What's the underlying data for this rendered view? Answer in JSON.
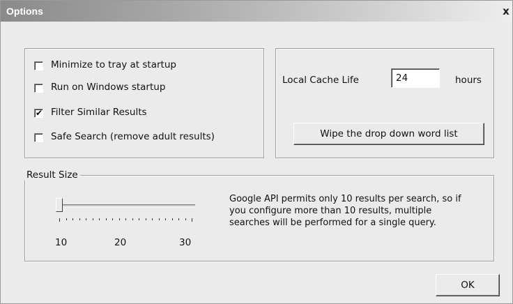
{
  "window": {
    "title": "Options",
    "close_glyph": "x"
  },
  "checkboxes": [
    {
      "label": "Minimize to tray at startup",
      "checked": false
    },
    {
      "label": "Run on Windows startup",
      "checked": false
    },
    {
      "label": "Filter Similar Results",
      "checked": true
    },
    {
      "label": "Safe Search (remove adult results)",
      "checked": false
    }
  ],
  "cache": {
    "label": "Local Cache Life",
    "value": "24",
    "unit": "hours",
    "wipe_button": "Wipe the drop down word list"
  },
  "result_size": {
    "legend": "Result Size",
    "value": 10,
    "min": 10,
    "max": 30,
    "tick_labels": [
      "10",
      "20",
      "30"
    ],
    "note_lines": [
      "Google API permits only 10 results per search, so if",
      "you configure more than 10 results, multiple",
      "searches will be performed for a single query."
    ]
  },
  "ok_button": "OK",
  "check_glyph": "✔"
}
